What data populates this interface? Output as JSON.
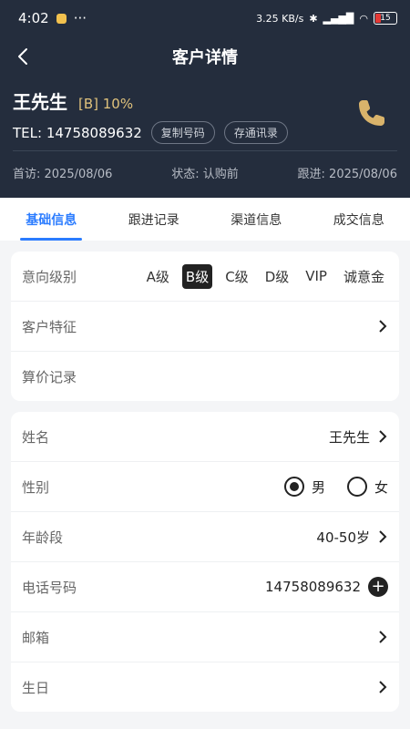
{
  "status_bar": {
    "time": "4:02",
    "dots": "···",
    "net_speed": "3.25 KB/s",
    "battery": "15"
  },
  "nav": {
    "title": "客户详情"
  },
  "profile": {
    "name": "王先生",
    "level": "[B] 10%",
    "tel": "TEL: 14758089632",
    "copy_label": "复制号码",
    "save_label": "存通讯录"
  },
  "dates": {
    "first_visit": "首访: 2025/08/06",
    "status": "状态: 认购前",
    "follow": "跟进: 2025/08/06"
  },
  "tabs": [
    "基础信息",
    "跟进记录",
    "渠道信息",
    "成交信息"
  ],
  "card1": {
    "intent_label": "意向级别",
    "grades": [
      "A级",
      "B级",
      "C级",
      "D级",
      "VIP",
      "诚意金"
    ],
    "features_label": "客户特征",
    "price_label": "算价记录"
  },
  "card2": {
    "name_label": "姓名",
    "name_value": "王先生",
    "gender_label": "性别",
    "male": "男",
    "female": "女",
    "age_label": "年龄段",
    "age_value": "40-50岁",
    "phone_label": "电话号码",
    "phone_value": "14758089632",
    "email_label": "邮箱",
    "birthday_label": "生日"
  },
  "colors": {
    "header_bg": "#242d3d",
    "accent": "#2b7cff",
    "level": "#e0c27c",
    "phone_icon": "#d9b36b"
  }
}
